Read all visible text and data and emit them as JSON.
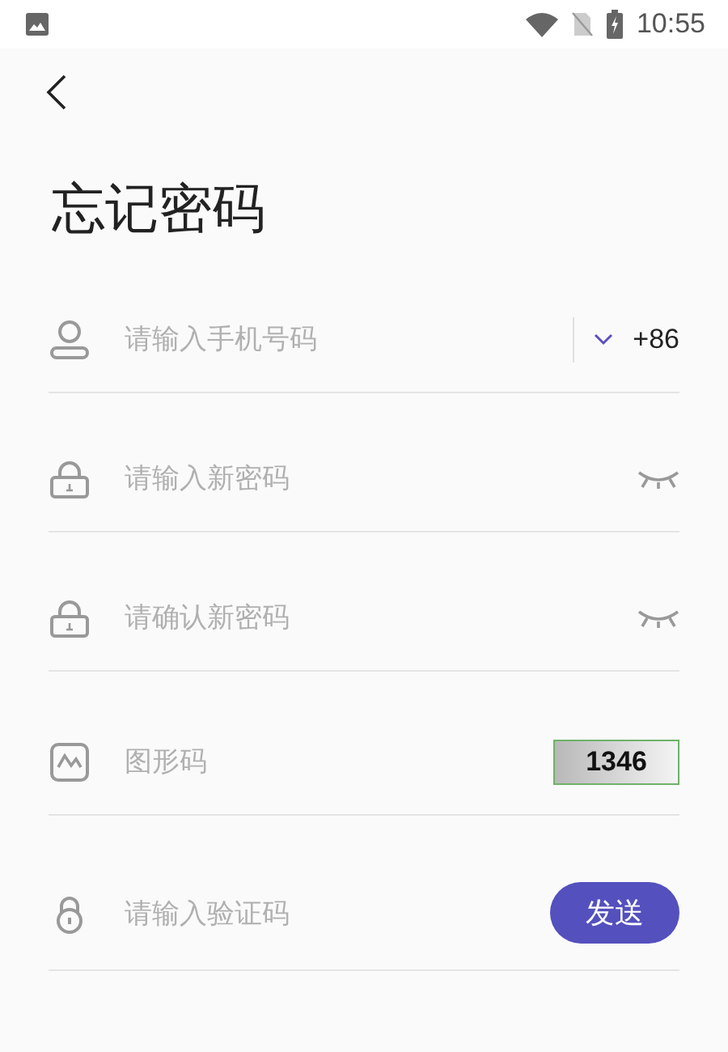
{
  "status_bar": {
    "time": "10:55"
  },
  "title": "忘记密码",
  "fields": [
    {
      "kind": "phone",
      "placeholder": "请输入手机号码",
      "country_code": "+86"
    },
    {
      "kind": "password",
      "placeholder": "请输入新密码",
      "visible": false
    },
    {
      "kind": "password",
      "placeholder": "请确认新密码",
      "visible": false
    },
    {
      "kind": "captcha",
      "placeholder": "图形码",
      "captcha": "1346"
    },
    {
      "kind": "sms",
      "placeholder": "请输入验证码",
      "button": "发送"
    }
  ]
}
